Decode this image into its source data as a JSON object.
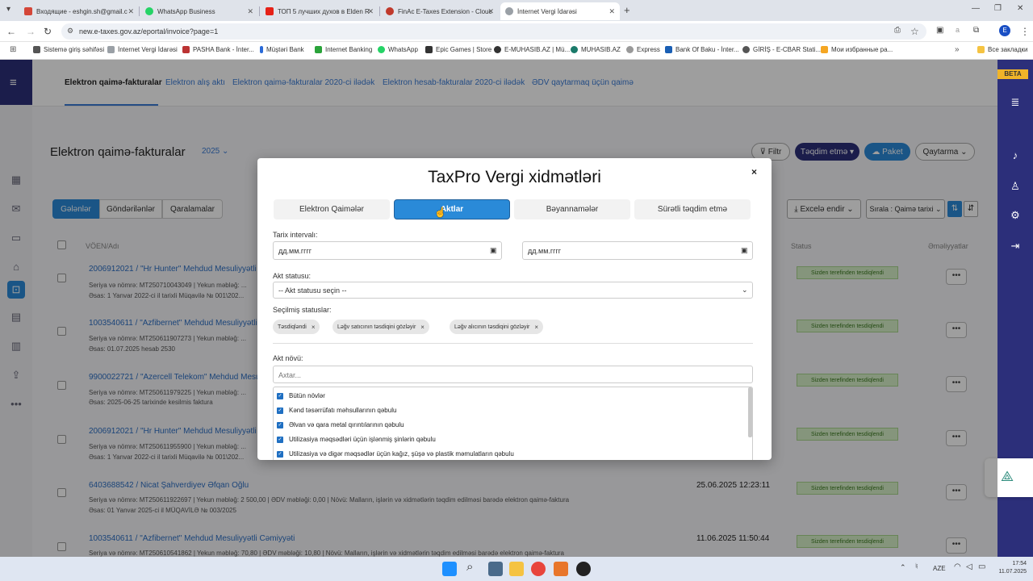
{
  "browser": {
    "tabs": [
      {
        "title": "Входящие - eshgin.sh@gmail.c",
        "color": "#d44638"
      },
      {
        "title": "WhatsApp Business",
        "color": "#25d366"
      },
      {
        "title": "ТОП 5 лучших духов в Elden R",
        "color": "#e62117"
      },
      {
        "title": "FinAc E-Taxes Extension - Clouc",
        "color": "#c0392b"
      },
      {
        "title": "İnternet Vergi İdarəsi",
        "color": "#9aa0a6"
      }
    ],
    "url": "new.e-taxes.gov.az/eportal/invoice?page=1",
    "bookmarks": [
      {
        "label": "Sistemə giriş səhifəsi",
        "color": "#555"
      },
      {
        "label": "İnternet Vergi İdarəsi",
        "color": "#9aa0a6"
      },
      {
        "label": "PASHA Bank - İnter...",
        "color": "#b33"
      },
      {
        "label": "Müştəri Bank",
        "color": "#2a6ad8"
      },
      {
        "label": "Internet Banking",
        "color": "#2aa33a"
      },
      {
        "label": "WhatsApp",
        "color": "#25d366"
      },
      {
        "label": "Epic Games | Store",
        "color": "#333"
      },
      {
        "label": "E-MUHASIB.AZ | Mü...",
        "color": "#333"
      },
      {
        "label": "MUHASIB.AZ",
        "color": "#1a7a6a"
      },
      {
        "label": "Express",
        "color": "#999"
      },
      {
        "label": "Bank Of Baku - İnter...",
        "color": "#1a5fb4"
      },
      {
        "label": "GİRİŞ - E-CBAR Stati...",
        "color": "#555"
      },
      {
        "label": "Мои избранные ра...",
        "color": "#f5a623"
      }
    ],
    "all_bookmarks": "Все закладки"
  },
  "app": {
    "beta": "BETA",
    "topnav": [
      "Elektron qaimə-fakturalar",
      "Elektron alış aktı",
      "Elektron qaimə-fakturalar 2020-ci ilədək",
      "Elektron hesab-fakturalar 2020-ci ilədək",
      "ƏDV qaytarmaq üçün qaimə"
    ],
    "page_title": "Elektron qaimə-fakturalar",
    "year": "2025",
    "buttons": {
      "filter": "Filtr",
      "submit": "Təqdim etmə",
      "package": "Paket",
      "qaytarma": "Qaytarma",
      "excel": "Excelə endir",
      "sort": "Sırala : Qaimə tarixi"
    },
    "segments": [
      "Gələnlər",
      "Göndərilənlər",
      "Qaralamalar"
    ],
    "columns": {
      "voen": "VÖEN/Adı",
      "status": "Status",
      "actions": "Əməliyyatlar"
    },
    "rows": [
      {
        "title": "2006912021 / \"Hr Hunter\" Mehdud Mesuliyyətli",
        "meta1": "Seriya və nömrə: MT250710043049 | Yekun məbləğ: ...",
        "meta2": "Əsas: 1 Yanvar 2022-ci il tarixli Müqavilə № 001\\202...",
        "date": "",
        "status": "Sizden terefinden tesdiqlendi"
      },
      {
        "title": "1003540611 / \"Azfibernet\" Mehdud Mesuliyyətli",
        "meta1": "Seriya və nömrə: MT250611907273 | Yekun məbləğ: ...",
        "meta2": "Əsas: 01.07.2025 hesab 2530",
        "date": "",
        "status": "Sizden terefinden tesdiqlendi"
      },
      {
        "title": "9900022721 / \"Azercell Telekom\" Mehdud Mesu...",
        "meta1": "Seriya və nömrə: MT250611979225 | Yekun məbləğ: ...",
        "meta2": "Əsas: 2025-06-25 tarixinde kesilmis faktura",
        "date": "",
        "status": "Sizden terefinden tesdiqlendi"
      },
      {
        "title": "2006912021 / \"Hr Hunter\" Mehdud Mesuliyyətli",
        "meta1": "Seriya və nömrə: MT250611955900 | Yekun məbləğ: ...",
        "meta2": "Əsas: 1 Yanvar 2022-ci il tarixli Müqavilə № 001\\202...",
        "date": "",
        "status": "Sizden terefinden tesdiqlendi"
      },
      {
        "title": "6403688542 / Nicat Şahverdiyev Əfqan Oğlu",
        "meta1": "Seriya və nömrə: MT250611922697 | Yekun məbləğ: 2 500,00 | ƏDV məbləği: 0,00 | Növü: Malların, işlərin və xidmətlərin təqdim edilməsi barədə elektron qaimə-faktura",
        "meta2": "Əsas: 01 Yanvar 2025-ci il MÜQAVİLƏ № 003/2025",
        "date": "25.06.2025 12:23:11",
        "status": "Sizden terefinden tesdiqlendi"
      },
      {
        "title": "1003540611 / \"Azfibernet\" Mehdud Mesuliyyətli Cəmiyyəti",
        "meta1": "Seriya və nömrə: MT250610541862 | Yekun məbləğ: 70,80 | ƏDV məbləği: 10,80 | Növü: Malların, işlərin və xidmətlərin təqdim edilməsi barədə elektron qaimə-faktura",
        "meta2": "",
        "date": "11.06.2025 11:50:44",
        "status": "Sizden terefinden tesdiqlendi"
      }
    ]
  },
  "modal": {
    "title": "TaxPro Vergi xidmətləri",
    "close": "×",
    "tabs": [
      "Elektron Qaimələr",
      "Aktlar",
      "Bəyannamələr",
      "Sürətli təqdim etmə"
    ],
    "active_tab": "Aktlar",
    "date_label": "Tarix intervalı:",
    "date_placeholder": "дд.мм.гггг",
    "status_label": "Akt statusu:",
    "status_select": "-- Akt statusu seçin --",
    "selected_label": "Seçilmiş statuslar:",
    "chips": [
      "Təsdiqləndi",
      "Ləğv satıcının təsdiqini gözləyir",
      "Ləğv alıcının təsdiqini gözləyir"
    ],
    "type_label": "Akt növü:",
    "search_placeholder": "Axtar...",
    "types": [
      "Bütün növlər",
      "Kənd təsərrüfatı məhsullarının qəbulu",
      "Əlvan və qara metal qırıntılarının qəbulu",
      "Utilizasiya məqsədləri üçün işlənmiş şinlərin qəbulu",
      "Utilizasiya və digər məqsədlər üçün kağız, şüşə və plastik məmulatların qəbulu"
    ]
  },
  "taskbar": {
    "lang": "AZE",
    "time": "17:54",
    "date": "11.07.2025"
  },
  "colors": {
    "accent": "#2a8ad8",
    "nav": "#2c2f7a",
    "status_bg": "#d7f0c8"
  }
}
